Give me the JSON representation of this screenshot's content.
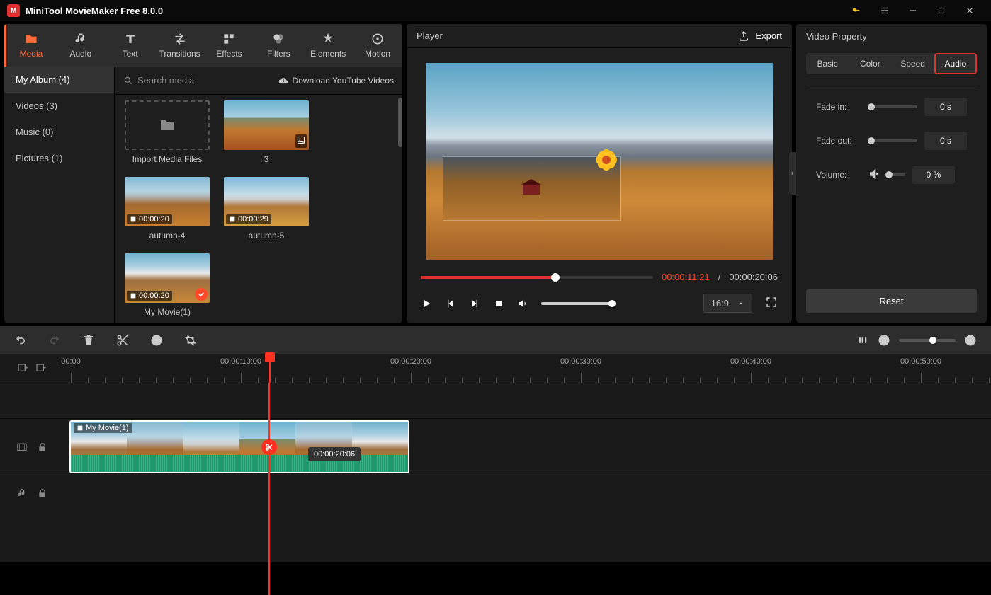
{
  "app": {
    "title": "MiniTool MovieMaker Free 8.0.0"
  },
  "main_tabs": [
    {
      "id": "media",
      "label": "Media"
    },
    {
      "id": "audio",
      "label": "Audio"
    },
    {
      "id": "text",
      "label": "Text"
    },
    {
      "id": "transitions",
      "label": "Transitions"
    },
    {
      "id": "effects",
      "label": "Effects"
    },
    {
      "id": "filters",
      "label": "Filters"
    },
    {
      "id": "elements",
      "label": "Elements"
    },
    {
      "id": "motion",
      "label": "Motion"
    }
  ],
  "album": {
    "items": [
      {
        "label": "My Album (4)"
      },
      {
        "label": "Videos (3)"
      },
      {
        "label": "Music (0)"
      },
      {
        "label": "Pictures (1)"
      }
    ]
  },
  "media_header": {
    "search_placeholder": "Search media",
    "download_label": "Download YouTube Videos"
  },
  "media_items": [
    {
      "type": "import",
      "label": "Import Media Files"
    },
    {
      "type": "image",
      "label": "3",
      "thumb": "land1"
    },
    {
      "type": "video",
      "label": "autumn-4",
      "duration": "00:00:20",
      "thumb": "land2"
    },
    {
      "type": "video",
      "label": "autumn-5",
      "duration": "00:00:29",
      "thumb": "land3"
    },
    {
      "type": "video",
      "label": "My Movie(1)",
      "duration": "00:00:20",
      "thumb": "land4",
      "checked": true
    }
  ],
  "player": {
    "title": "Player",
    "export_label": "Export",
    "current_time": "00:00:11:21",
    "total_time": "00:00:20:06",
    "time_sep": " / ",
    "ratio": "16:9"
  },
  "property": {
    "title": "Video Property",
    "tabs": [
      {
        "label": "Basic"
      },
      {
        "label": "Color"
      },
      {
        "label": "Speed"
      },
      {
        "label": "Audio"
      }
    ],
    "fade_in": {
      "label": "Fade in:",
      "value": "0 s"
    },
    "fade_out": {
      "label": "Fade out:",
      "value": "0 s"
    },
    "volume": {
      "label": "Volume:",
      "value": "0 %"
    },
    "reset_label": "Reset"
  },
  "timeline": {
    "ruler": [
      "00:00",
      "00:00:10:00",
      "00:00:20:00",
      "00:00:30:00",
      "00:00:40:00",
      "00:00:50:00"
    ],
    "clip": {
      "label": "My Movie(1)",
      "duration_tooltip": "00:00:20:06"
    }
  }
}
